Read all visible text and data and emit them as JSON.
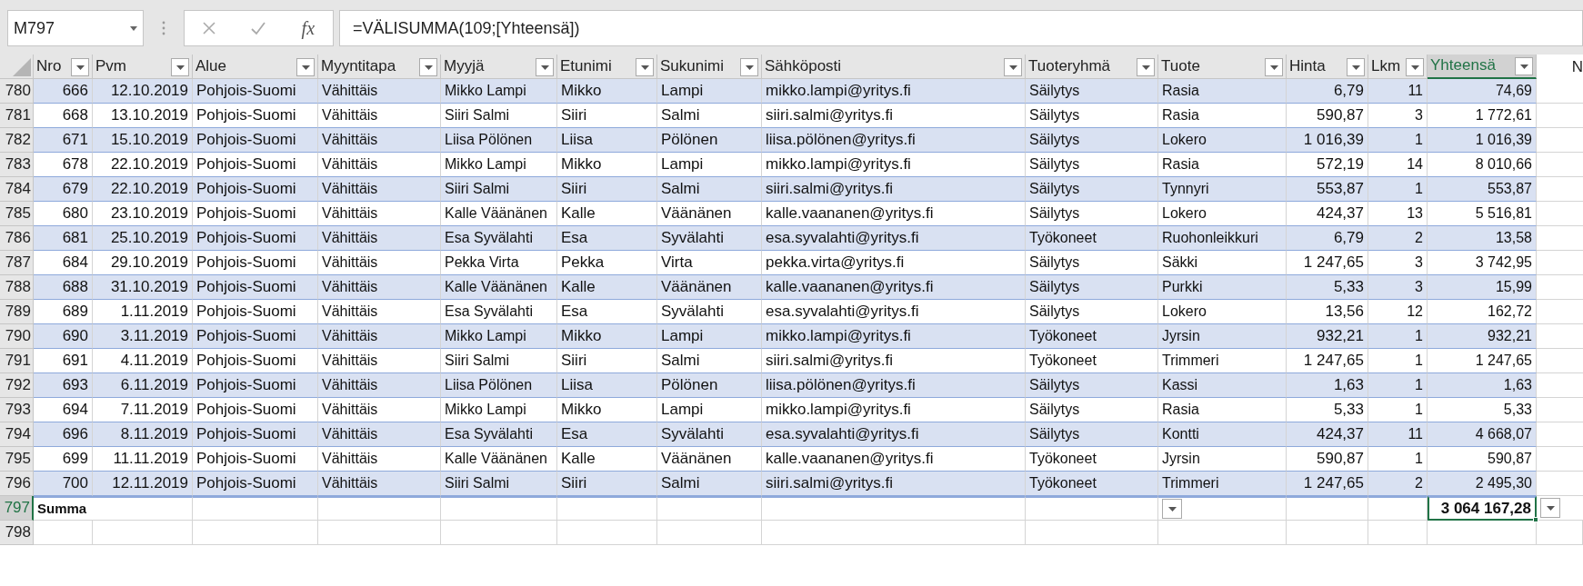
{
  "name_box": "M797",
  "formula_bar": {
    "function_label": "fx",
    "formula": "=VÄLISUMMA(109;[Yhteensä])"
  },
  "columns": [
    {
      "label": "Nro",
      "selected": false
    },
    {
      "label": "Pvm",
      "selected": false
    },
    {
      "label": "Alue",
      "selected": false
    },
    {
      "label": "Myyntitapa",
      "selected": false
    },
    {
      "label": "Myyjä",
      "selected": false
    },
    {
      "label": "Etunimi",
      "selected": false
    },
    {
      "label": "Sukunimi",
      "selected": false
    },
    {
      "label": "Sähköposti",
      "selected": false
    },
    {
      "label": "Tuoteryhmä",
      "selected": false
    },
    {
      "label": "Tuote",
      "selected": false
    },
    {
      "label": "Hinta",
      "selected": false
    },
    {
      "label": "Lkm",
      "selected": false
    },
    {
      "label": "Yhteensä",
      "selected": true
    }
  ],
  "next_column_header": "N",
  "rows": [
    {
      "row_number": "780",
      "cells": [
        "666",
        "12.10.2019",
        "Pohjois-Suomi",
        "Vähittäis",
        "Mikko Lampi",
        "Mikko",
        "Lampi",
        "mikko.lampi@yritys.fi",
        "Säilytys",
        "Rasia",
        "6,79",
        "11",
        "74,69"
      ]
    },
    {
      "row_number": "781",
      "cells": [
        "668",
        "13.10.2019",
        "Pohjois-Suomi",
        "Vähittäis",
        "Siiri Salmi",
        "Siiri",
        "Salmi",
        "siiri.salmi@yritys.fi",
        "Säilytys",
        "Rasia",
        "590,87",
        "3",
        "1 772,61"
      ]
    },
    {
      "row_number": "782",
      "cells": [
        "671",
        "15.10.2019",
        "Pohjois-Suomi",
        "Vähittäis",
        "Liisa Pölönen",
        "Liisa",
        "Pölönen",
        "liisa.pölönen@yritys.fi",
        "Säilytys",
        "Lokero",
        "1 016,39",
        "1",
        "1 016,39"
      ]
    },
    {
      "row_number": "783",
      "cells": [
        "678",
        "22.10.2019",
        "Pohjois-Suomi",
        "Vähittäis",
        "Mikko Lampi",
        "Mikko",
        "Lampi",
        "mikko.lampi@yritys.fi",
        "Säilytys",
        "Rasia",
        "572,19",
        "14",
        "8 010,66"
      ]
    },
    {
      "row_number": "784",
      "cells": [
        "679",
        "22.10.2019",
        "Pohjois-Suomi",
        "Vähittäis",
        "Siiri Salmi",
        "Siiri",
        "Salmi",
        "siiri.salmi@yritys.fi",
        "Säilytys",
        "Tynnyri",
        "553,87",
        "1",
        "553,87"
      ]
    },
    {
      "row_number": "785",
      "cells": [
        "680",
        "23.10.2019",
        "Pohjois-Suomi",
        "Vähittäis",
        "Kalle Väänänen",
        "Kalle",
        "Väänänen",
        "kalle.vaananen@yritys.fi",
        "Säilytys",
        "Lokero",
        "424,37",
        "13",
        "5 516,81"
      ]
    },
    {
      "row_number": "786",
      "cells": [
        "681",
        "25.10.2019",
        "Pohjois-Suomi",
        "Vähittäis",
        "Esa Syvälahti",
        "Esa",
        "Syvälahti",
        "esa.syvalahti@yritys.fi",
        "Työkoneet",
        "Ruohonleikkuri",
        "6,79",
        "2",
        "13,58"
      ]
    },
    {
      "row_number": "787",
      "cells": [
        "684",
        "29.10.2019",
        "Pohjois-Suomi",
        "Vähittäis",
        "Pekka Virta",
        "Pekka",
        "Virta",
        "pekka.virta@yritys.fi",
        "Säilytys",
        "Säkki",
        "1 247,65",
        "3",
        "3 742,95"
      ]
    },
    {
      "row_number": "788",
      "cells": [
        "688",
        "31.10.2019",
        "Pohjois-Suomi",
        "Vähittäis",
        "Kalle Väänänen",
        "Kalle",
        "Väänänen",
        "kalle.vaananen@yritys.fi",
        "Säilytys",
        "Purkki",
        "5,33",
        "3",
        "15,99"
      ]
    },
    {
      "row_number": "789",
      "cells": [
        "689",
        "1.11.2019",
        "Pohjois-Suomi",
        "Vähittäis",
        "Esa Syvälahti",
        "Esa",
        "Syvälahti",
        "esa.syvalahti@yritys.fi",
        "Säilytys",
        "Lokero",
        "13,56",
        "12",
        "162,72"
      ]
    },
    {
      "row_number": "790",
      "cells": [
        "690",
        "3.11.2019",
        "Pohjois-Suomi",
        "Vähittäis",
        "Mikko Lampi",
        "Mikko",
        "Lampi",
        "mikko.lampi@yritys.fi",
        "Työkoneet",
        "Jyrsin",
        "932,21",
        "1",
        "932,21"
      ]
    },
    {
      "row_number": "791",
      "cells": [
        "691",
        "4.11.2019",
        "Pohjois-Suomi",
        "Vähittäis",
        "Siiri Salmi",
        "Siiri",
        "Salmi",
        "siiri.salmi@yritys.fi",
        "Työkoneet",
        "Trimmeri",
        "1 247,65",
        "1",
        "1 247,65"
      ]
    },
    {
      "row_number": "792",
      "cells": [
        "693",
        "6.11.2019",
        "Pohjois-Suomi",
        "Vähittäis",
        "Liisa Pölönen",
        "Liisa",
        "Pölönen",
        "liisa.pölönen@yritys.fi",
        "Säilytys",
        "Kassi",
        "1,63",
        "1",
        "1,63"
      ]
    },
    {
      "row_number": "793",
      "cells": [
        "694",
        "7.11.2019",
        "Pohjois-Suomi",
        "Vähittäis",
        "Mikko Lampi",
        "Mikko",
        "Lampi",
        "mikko.lampi@yritys.fi",
        "Säilytys",
        "Rasia",
        "5,33",
        "1",
        "5,33"
      ]
    },
    {
      "row_number": "794",
      "cells": [
        "696",
        "8.11.2019",
        "Pohjois-Suomi",
        "Vähittäis",
        "Esa Syvälahti",
        "Esa",
        "Syvälahti",
        "esa.syvalahti@yritys.fi",
        "Säilytys",
        "Kontti",
        "424,37",
        "11",
        "4 668,07"
      ]
    },
    {
      "row_number": "795",
      "cells": [
        "699",
        "11.11.2019",
        "Pohjois-Suomi",
        "Vähittäis",
        "Kalle Väänänen",
        "Kalle",
        "Väänänen",
        "kalle.vaananen@yritys.fi",
        "Työkoneet",
        "Jyrsin",
        "590,87",
        "1",
        "590,87"
      ]
    },
    {
      "row_number": "796",
      "cells": [
        "700",
        "12.11.2019",
        "Pohjois-Suomi",
        "Vähittäis",
        "Siiri Salmi",
        "Siiri",
        "Salmi",
        "siiri.salmi@yritys.fi",
        "Työkoneet",
        "Trimmeri",
        "1 247,65",
        "2",
        "2 495,30"
      ]
    }
  ],
  "total_row": {
    "row_number": "797",
    "label": "Summa",
    "total": "3 064 167,28",
    "selected": true
  },
  "empty_row": {
    "row_number": "798"
  }
}
